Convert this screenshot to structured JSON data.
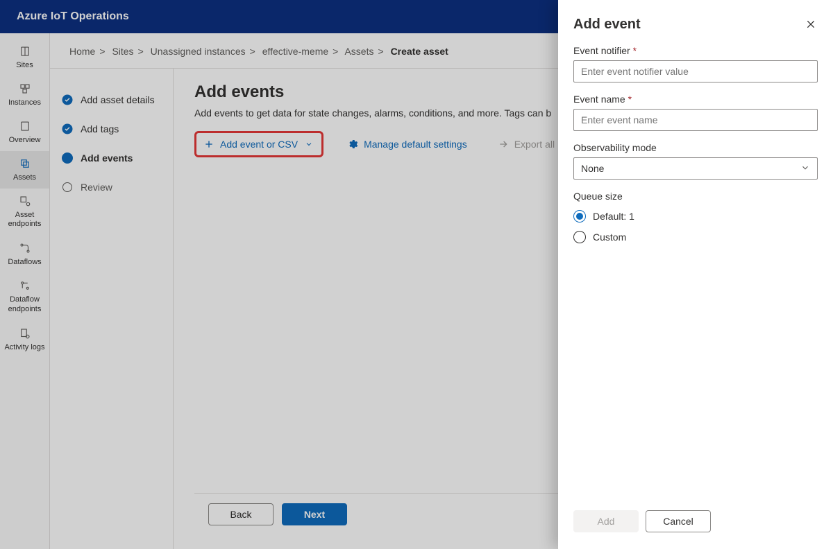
{
  "topbar": {
    "title": "Azure IoT Operations"
  },
  "leftnav": {
    "items": [
      {
        "label": "Sites",
        "icon": "book-icon"
      },
      {
        "label": "Instances",
        "icon": "grid-icon"
      },
      {
        "label": "Overview",
        "icon": "page-icon"
      },
      {
        "label": "Assets",
        "icon": "assets-icon"
      },
      {
        "label": "Asset endpoints",
        "icon": "endpoint-icon"
      },
      {
        "label": "Dataflows",
        "icon": "dataflow-icon"
      },
      {
        "label": "Dataflow endpoints",
        "icon": "dfend-icon"
      },
      {
        "label": "Activity logs",
        "icon": "logs-icon"
      }
    ],
    "active_index": 3
  },
  "breadcrumb": {
    "items": [
      "Home",
      "Sites",
      "Unassigned instances",
      "effective-meme",
      "Assets"
    ],
    "current": "Create asset"
  },
  "wizard": {
    "steps": [
      {
        "label": "Add asset details",
        "state": "done"
      },
      {
        "label": "Add tags",
        "state": "done"
      },
      {
        "label": "Add events",
        "state": "current"
      },
      {
        "label": "Review",
        "state": "future"
      }
    ]
  },
  "main": {
    "heading": "Add events",
    "description": "Add events to get data for state changes, alarms, conditions, and more. Tags can b",
    "actions": {
      "add_label": "Add event or CSV",
      "manage_label": "Manage default settings",
      "export_label": "Export all"
    },
    "footer": {
      "back": "Back",
      "next": "Next"
    }
  },
  "panel": {
    "title": "Add event",
    "event_notifier": {
      "label": "Event notifier",
      "placeholder": "Enter event notifier value",
      "value": ""
    },
    "event_name": {
      "label": "Event name",
      "placeholder": "Enter event name",
      "value": ""
    },
    "observability": {
      "label": "Observability mode",
      "selected": "None"
    },
    "queue_size": {
      "label": "Queue size",
      "options": [
        {
          "label": "Default: 1",
          "value": "default",
          "checked": true
        },
        {
          "label": "Custom",
          "value": "custom",
          "checked": false
        }
      ]
    },
    "footer": {
      "add": "Add",
      "cancel": "Cancel"
    }
  }
}
